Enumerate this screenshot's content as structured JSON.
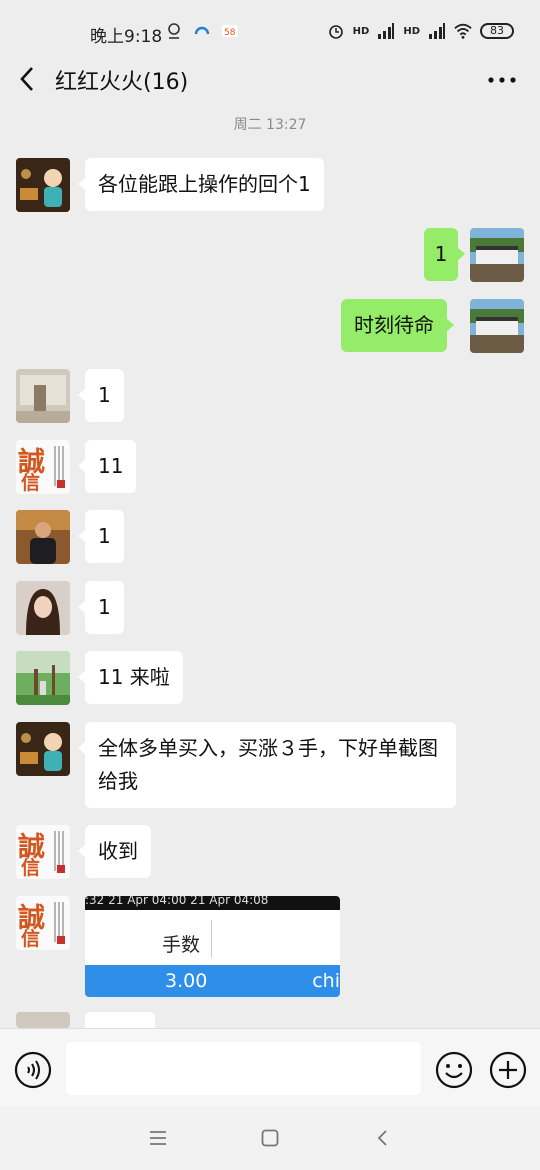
{
  "status_bar": {
    "time": "晚上9:18",
    "hd1": "HD",
    "hd2": "HD",
    "battery": "83"
  },
  "header": {
    "title": "红红火火(16)"
  },
  "timestamp": "周二 13:27",
  "messages": [
    {
      "side": "left",
      "avatar": "avatar-elder",
      "text": "各位能跟上操作的回个1"
    },
    {
      "side": "right",
      "avatar": "avatar-self",
      "text": "1"
    },
    {
      "side": "right",
      "avatar": "avatar-self",
      "text": "时刻待命"
    },
    {
      "side": "left",
      "avatar": "avatar-room",
      "text": "1"
    },
    {
      "side": "left",
      "avatar": "avatar-calligraphy",
      "text": "11"
    },
    {
      "side": "left",
      "avatar": "avatar-man",
      "text": "1"
    },
    {
      "side": "left",
      "avatar": "avatar-woman",
      "text": "1"
    },
    {
      "side": "left",
      "avatar": "avatar-trees",
      "text": "11 来啦"
    },
    {
      "side": "left",
      "avatar": "avatar-elder",
      "text": "全体多单买入，买涨３手，下好单截图给我"
    },
    {
      "side": "left",
      "avatar": "avatar-calligraphy",
      "text": "收到"
    }
  ],
  "image_message": {
    "header_text": ":32   21 Apr 04:00   21 Apr 04:08",
    "column_label": "手数",
    "value": "3.00",
    "value_right": "chi"
  },
  "calligraphy": {
    "char1": "誠",
    "char2": "信"
  },
  "colors": {
    "background": "#ededed",
    "bubble_self": "#95ec69",
    "bubble_other": "#ffffff",
    "accent_blue": "#2f8fe8"
  }
}
